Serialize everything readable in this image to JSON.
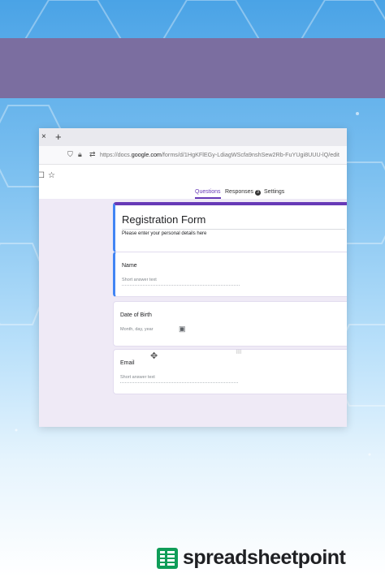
{
  "browser": {
    "close_tab": "×",
    "new_tab": "+",
    "url_prefix": "https://docs.",
    "url_domain": "google.com",
    "url_rest": "/forms/d/1HgKFlEGy-LdiagWScfa9nshSew2Rb-FuYUgi8UUU-lQ/edit"
  },
  "form_tabs": {
    "questions": "Questions",
    "responses": "Responses",
    "responses_count": "3",
    "settings": "Settings"
  },
  "form": {
    "title": "Registration Form",
    "description": "Please enter your personal details here",
    "questions": [
      {
        "label": "Name",
        "hint": "Short answer text"
      },
      {
        "label": "Date of Birth",
        "hint": "Month, day, year"
      },
      {
        "label": "Email",
        "hint": "Short answer text"
      }
    ]
  },
  "brand": {
    "name": "spreadsheetpoint",
    "accent": "#673ab7",
    "banner_color": "#7b6ea0",
    "logo_color": "#0f9d58"
  }
}
